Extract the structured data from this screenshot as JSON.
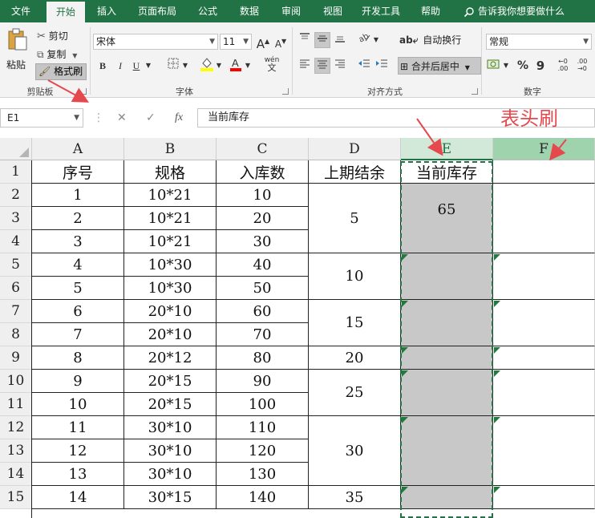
{
  "menu": {
    "tabs": [
      "文件",
      "开始",
      "插入",
      "页面布局",
      "公式",
      "数据",
      "审阅",
      "视图",
      "开发工具",
      "帮助"
    ],
    "active_tab": "开始",
    "tell_me": "告诉我你想要做什么"
  },
  "ribbon": {
    "clipboard": {
      "paste": "粘贴",
      "cut": "剪切",
      "copy": "复制",
      "format_painter": "格式刷",
      "label": "剪贴板"
    },
    "font": {
      "name": "宋体",
      "size": "11",
      "grow": "A",
      "shrink": "A",
      "bold": "B",
      "italic": "I",
      "underline": "U",
      "wen": "wén",
      "label": "字体"
    },
    "alignment": {
      "wrap_text": "自动换行",
      "merge_center": "合并后居中",
      "label": "对齐方式"
    },
    "number": {
      "format": "常规",
      "percent": "%",
      "comma": "9",
      "label": "数字"
    }
  },
  "formula_bar": {
    "name_box": "E1",
    "fx": "fx",
    "content": "当前库存"
  },
  "sheet": {
    "columns": [
      "A",
      "B",
      "C",
      "D",
      "E",
      "F"
    ],
    "rows": [
      "1",
      "2",
      "3",
      "4",
      "5",
      "6",
      "7",
      "8",
      "9",
      "10",
      "11",
      "12",
      "13",
      "14",
      "15"
    ],
    "header": [
      "序号",
      "规格",
      "入库数",
      "上期结余",
      "当前库存"
    ],
    "data": [
      [
        "1",
        "10*21",
        "10"
      ],
      [
        "2",
        "10*21",
        "20"
      ],
      [
        "3",
        "10*21",
        "30"
      ],
      [
        "4",
        "10*30",
        "40"
      ],
      [
        "5",
        "10*30",
        "50"
      ],
      [
        "6",
        "20*10",
        "60"
      ],
      [
        "7",
        "20*10",
        "70"
      ],
      [
        "8",
        "20*12",
        "80"
      ],
      [
        "9",
        "20*15",
        "90"
      ],
      [
        "10",
        "20*15",
        "100"
      ],
      [
        "11",
        "30*10",
        "110"
      ],
      [
        "12",
        "30*10",
        "120"
      ],
      [
        "13",
        "30*10",
        "130"
      ],
      [
        "14",
        "30*15",
        "140"
      ]
    ],
    "d_merged": [
      "5",
      "10",
      "15",
      "20",
      "25",
      "30",
      "35"
    ],
    "e_values": [
      "65"
    ]
  },
  "annotation": "表头刷",
  "colors": {
    "excel_green": "#217346",
    "selected_fill": "#c8c8c8",
    "annotation_red": "#e5484d"
  }
}
